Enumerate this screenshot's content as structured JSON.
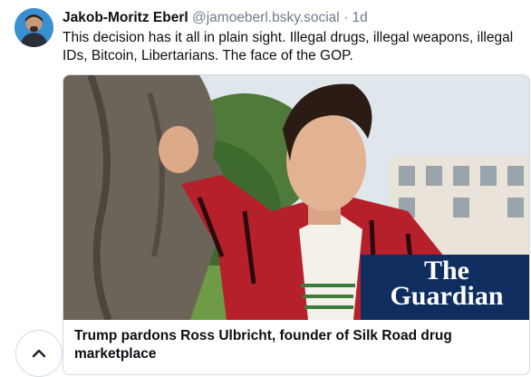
{
  "post": {
    "author_name": "Jakob-Moritz Eberl",
    "handle": "@jamoeberl.bsky.social",
    "separator": "·",
    "time": "1d",
    "text": "This decision has it all in plain sight. Illegal drugs, illegal weapons, illegal IDs, Bitcoin, Libertarians. The face of the GOP."
  },
  "card": {
    "logo_line1": "The",
    "logo_line2": "Guardian",
    "title": "Trump pardons Ross Ulbricht, founder of Silk Road drug marketplace"
  },
  "icons": {
    "scroll_top": "chevron-up-icon"
  },
  "colors": {
    "guardian_blue": "#0f2d5e",
    "handle_gray": "#6f7c8a",
    "border": "#d4dbe2"
  }
}
